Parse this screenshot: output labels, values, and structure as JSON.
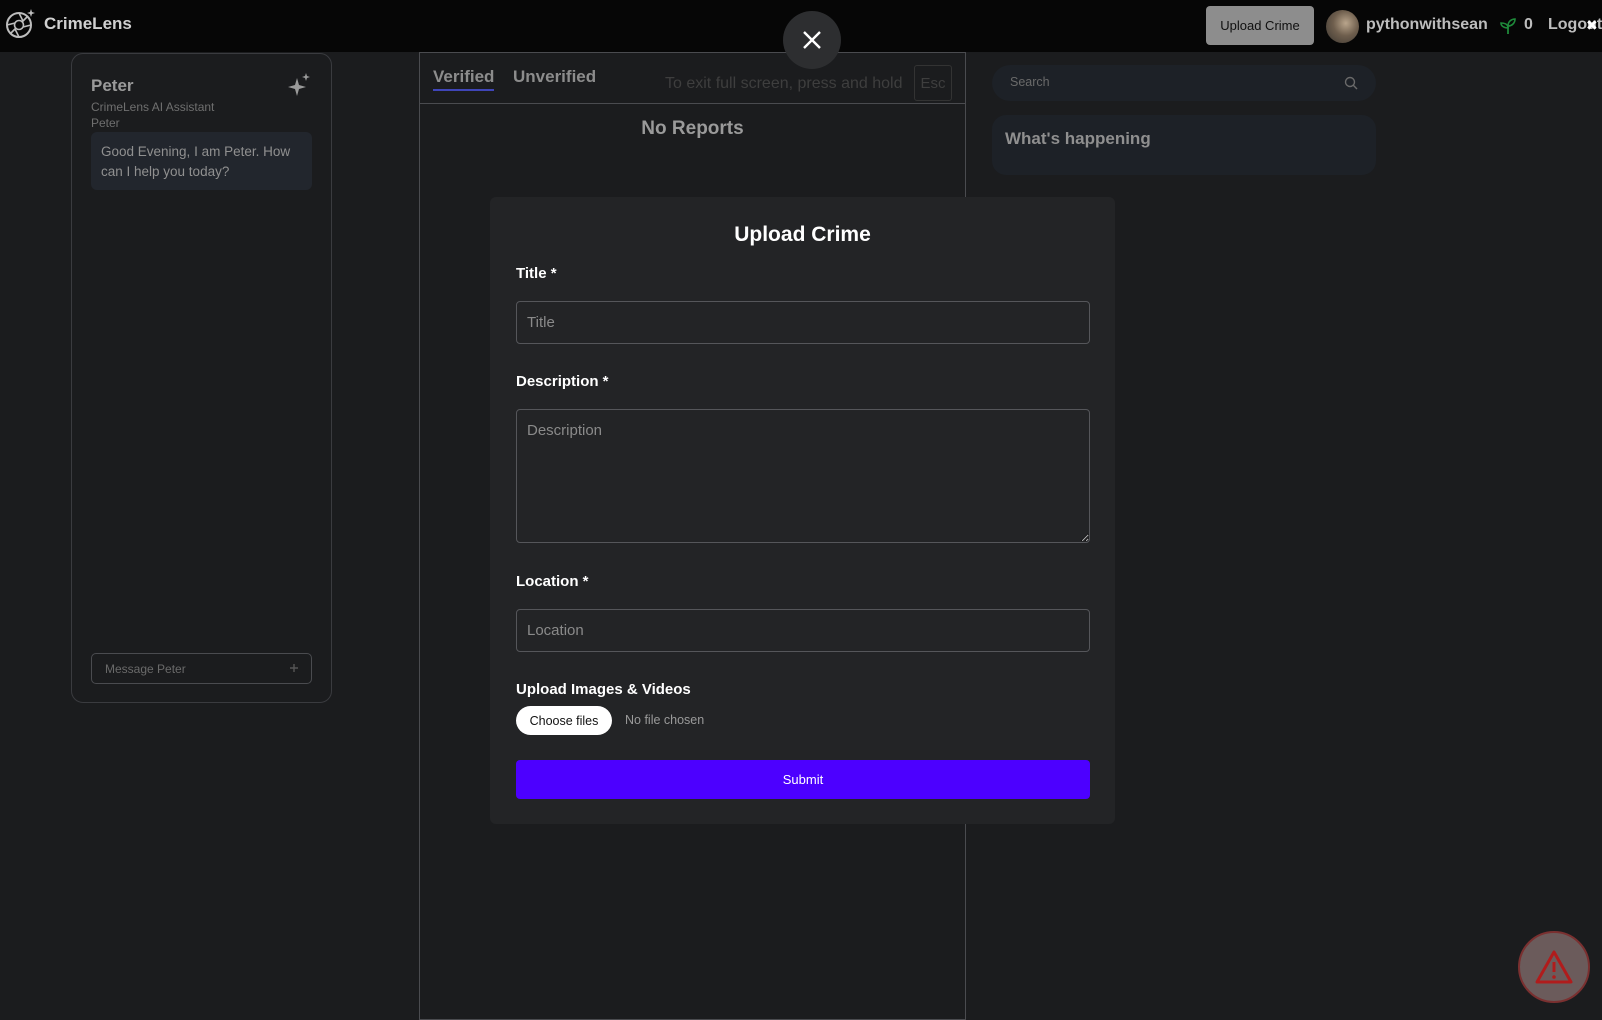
{
  "brand": {
    "name": "CrimeLens"
  },
  "header": {
    "upload_label": "Upload Crime",
    "username": "pythonwithsean",
    "points": "0",
    "logout_label": "Logout",
    "fullscreen_close": "✖"
  },
  "chat": {
    "name": "Peter",
    "subtitle": "CrimeLens AI Assistant",
    "sender": "Peter",
    "greeting": "Good Evening, I am Peter. How can I help you today?",
    "input_placeholder": "Message Peter"
  },
  "feed": {
    "tabs": [
      {
        "label": "Verified",
        "active": true
      },
      {
        "label": "Unverified",
        "active": false
      }
    ],
    "fullscreen_hint": "To exit full screen, press and hold",
    "esc_key": "Esc",
    "empty_text": "No Reports"
  },
  "sidebar": {
    "search_placeholder": "Search",
    "happening_title": "What's happening"
  },
  "modal": {
    "title": "Upload Crime",
    "title_label": "Title *",
    "title_placeholder": "Title",
    "title_value": "",
    "description_label": "Description *",
    "description_placeholder": "Description",
    "description_value": "",
    "location_label": "Location *",
    "location_placeholder": "Location",
    "location_value": "",
    "media_label": "Upload Images & Videos",
    "choose_label": "Choose files",
    "no_file_text": "No file chosen",
    "submit_label": "Submit"
  },
  "colors": {
    "accent": "#4c00ff",
    "background": "#1b1c1e",
    "modal": "#232426",
    "topbar": "#060606"
  }
}
